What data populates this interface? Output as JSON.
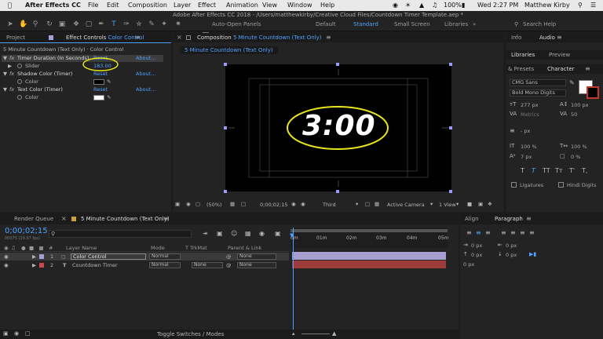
{
  "menubar": {
    "app": "After Effects CC",
    "items": [
      "File",
      "Edit",
      "Composition",
      "Layer",
      "Effect",
      "Animation",
      "View",
      "Window",
      "Help"
    ],
    "battery": "100%",
    "clock": "Wed 2:27 PM",
    "user": "Matthew Kirby"
  },
  "toolbar": {
    "title": "Adobe After Effects CC 2018 - /Users/matthewkirby/Creative Cloud Files/Countdown Timer Template.aep *",
    "auto_open": "Auto-Open Panels",
    "workspaces": [
      "Default",
      "Standard",
      "Small Screen",
      "Libraries"
    ],
    "search": "Search Help"
  },
  "effect_controls": {
    "tab_project": "Project",
    "tab_label": "Effect Controls",
    "tab_target": "Color Control",
    "breadcrumb": "5 Minute Countdown (Text Only) · Color Control",
    "effects": [
      {
        "name": "Timer Duration (In Seconds)",
        "reset": "Reset",
        "about": "About..."
      },
      {
        "name": "Shadow Color (Timer)",
        "reset": "Reset",
        "about": "About..."
      },
      {
        "name": "Text Color (Timer)",
        "reset": "Reset",
        "about": "About..."
      }
    ],
    "slider_label": "Slider",
    "slider_value": "183.00",
    "color_label": "Color",
    "shadow_color": "#000000",
    "text_color": "#ffffff",
    "highlight_color": "#e8e51c"
  },
  "composition": {
    "tab_label": "Composition",
    "tab_target": "5 Minute Countdown (Text Only)",
    "subtab": "5 Minute Countdown (Text Only)",
    "timer_text": "3:00",
    "zoom": "(50%)",
    "timecode": "0;00;02;15",
    "resolution": "Third",
    "camera": "Active Camera",
    "views": "1 View"
  },
  "timeline": {
    "tab_render": "Render Queue",
    "tab_comp": "5 Minute Countdown (Text Only)",
    "timecode": "0;00;02;15",
    "frames": "00075 (29.97 fps)",
    "headers": {
      "layer_name": "Layer Name",
      "mode": "Mode",
      "trkmat": "T TrkMat",
      "parent": "Parent & Link"
    },
    "layers": [
      {
        "num": "1",
        "name": "Color Control",
        "mode": "Normal",
        "trkmat": "",
        "parent": "None",
        "label_color": "#a79fcf",
        "bar_color": "#a79fcf"
      },
      {
        "num": "2",
        "name": "Countdown Timer",
        "mode": "Normal",
        "trkmat": "None",
        "parent": "None",
        "label_color": "#c94a4a",
        "bar_color": "#9e3b3b"
      }
    ],
    "ruler": [
      "0m",
      "01m",
      "02m",
      "03m",
      "04m",
      "05m"
    ],
    "footer": "Toggle Switches / Modes"
  },
  "right_top": {
    "tab_info": "Info",
    "tab_audio": "Audio"
  },
  "libraries": {
    "tab_libraries": "Libraries",
    "tab_preview": "Preview"
  },
  "character": {
    "tab_presets": "& Presets",
    "tab_character": "Character",
    "font": "CMG Sans",
    "style": "Bold Mono Digits",
    "size": "277 px",
    "leading": "100 px",
    "kerning": "Metrics",
    "tracking": "50",
    "stroke": "- px",
    "vscale": "100 %",
    "hscale": "100 %",
    "baseline": "7 px",
    "tsume": "0 %",
    "ligatures": "Ligatures",
    "hindi": "Hindi Digits",
    "style_buttons": [
      "T",
      "T",
      "TT",
      "Tт",
      "T'",
      "T,"
    ]
  },
  "paragraph": {
    "tab_align": "Align",
    "tab_paragraph": "Paragraph",
    "indent_values": [
      "0 px",
      "0 px",
      "0 px",
      "0 px",
      "0 px"
    ]
  }
}
